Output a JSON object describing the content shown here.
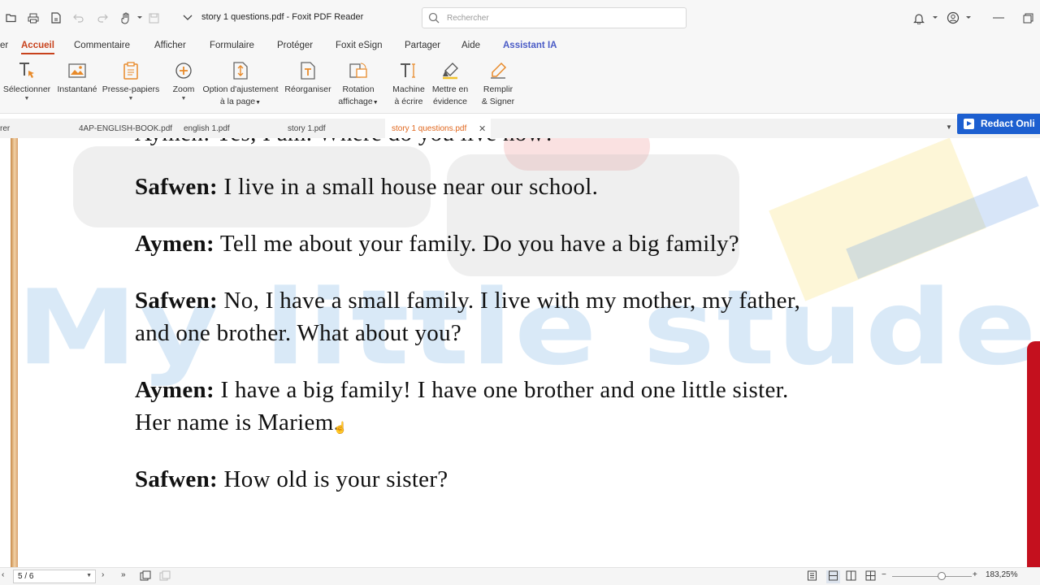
{
  "window": {
    "title": "story 1 questions.pdf - Foxit PDF Reader",
    "search_placeholder": "Rechercher"
  },
  "icons": {
    "quick_access": [
      "folder-open-icon",
      "print-icon",
      "save-icon",
      "undo-icon",
      "redo-icon",
      "hand-tool-icon",
      "save-disk-icon",
      "dropdown-icon"
    ],
    "right": [
      "bell-icon",
      "account-icon",
      "minimize-icon",
      "restore-icon"
    ]
  },
  "menu": {
    "partial_left": "er",
    "tabs": [
      "Accueil",
      "Commentaire",
      "Afficher",
      "Formulaire",
      "Protéger",
      "Foxit eSign",
      "Partager",
      "Aide",
      "Assistant IA"
    ]
  },
  "ribbon": {
    "select": "Sélectionner",
    "snapshot": "Instantané",
    "clipboard": "Presse-papiers",
    "zoom": "Zoom",
    "fit_line1": "Option d'ajustement",
    "fit_line2": "à la page",
    "reorganize": "Réorganiser",
    "rotate_line1": "Rotation",
    "rotate_line2": "affichage",
    "typewriter_line1": "Machine",
    "typewriter_line2": "à écrire",
    "highlight_line1": "Mettre en",
    "highlight_line2": "évidence",
    "fill_line1": "Remplir",
    "fill_line2": "& Signer"
  },
  "doc_tabs": {
    "partial": "rer",
    "tabs": [
      "4AP-ENGLISH-BOOK.pdf",
      "english 1.pdf",
      "story 1.pdf",
      "story 1 questions.pdf"
    ],
    "active": "story 1 questions.pdf",
    "redact_label": "Redact Onli"
  },
  "document": {
    "watermark": "My little student",
    "top_partial": "Aymen: Yes, I am. Where do you live now?",
    "lines": [
      {
        "speaker": "Safwen:",
        "text": " I live in a small house near our school."
      },
      {
        "speaker": "Aymen:",
        "text": " Tell me about your family. Do you have a big family?"
      },
      {
        "speaker": "Safwen:",
        "text": " No, I have a small family. I live with my mother, my father,"
      },
      {
        "speaker": "",
        "text": "and one brother. What about you?"
      },
      {
        "speaker": "Aymen:",
        "text": " I have a big family! I have one brother and one little sister."
      },
      {
        "speaker": "",
        "text": "Her name is Mariem."
      },
      {
        "speaker": "Safwen:",
        "text": " How old is your sister?"
      }
    ]
  },
  "status": {
    "page_indicator": "5 / 6",
    "zoom": "183,25%"
  }
}
